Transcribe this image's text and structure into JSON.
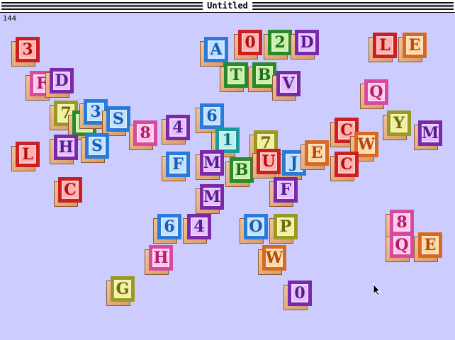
{
  "window": {
    "title": "Untitled",
    "counter": "144"
  },
  "colors": {
    "r": {
      "border": "#cc2020",
      "face": "#ffb0b0",
      "text": "#b01010"
    },
    "g": {
      "border": "#2a8a2a",
      "face": "#c8f0a8",
      "text": "#1e6e1e"
    },
    "b": {
      "border": "#2a7ad8",
      "face": "#bfe0ff",
      "text": "#1a5ab0"
    },
    "p": {
      "border": "#7a2aa8",
      "face": "#e2c0ff",
      "text": "#5a1a8a"
    },
    "o": {
      "border": "#d86a20",
      "face": "#ffd8a8",
      "text": "#b04a10"
    },
    "k": {
      "border": "#d84aa0",
      "face": "#ffc8e8",
      "text": "#b01a70"
    },
    "t": {
      "border": "#1a9a9a",
      "face": "#b8f0f0",
      "text": "#107070"
    },
    "y": {
      "border": "#9a9a20",
      "face": "#f0f0a0",
      "text": "#6a6a10"
    }
  },
  "tiles": [
    {
      "ch": "3",
      "c": "r"
    },
    {
      "ch": "F",
      "c": "k"
    },
    {
      "ch": "D",
      "c": "p"
    },
    {
      "ch": "7",
      "c": "y"
    },
    {
      "ch": "2",
      "c": "g"
    },
    {
      "ch": "3",
      "c": "b"
    },
    {
      "ch": "S",
      "c": "b"
    },
    {
      "ch": "H",
      "c": "p"
    },
    {
      "ch": "S",
      "c": "b"
    },
    {
      "ch": "L",
      "c": "r"
    },
    {
      "ch": "C",
      "c": "r"
    },
    {
      "ch": "8",
      "c": "k"
    },
    {
      "ch": "4",
      "c": "p"
    },
    {
      "ch": "F",
      "c": "b"
    },
    {
      "ch": "6",
      "c": "b"
    },
    {
      "ch": "1",
      "c": "t"
    },
    {
      "ch": "7",
      "c": "y"
    },
    {
      "ch": "M",
      "c": "p"
    },
    {
      "ch": "B",
      "c": "g"
    },
    {
      "ch": "J",
      "c": "b"
    },
    {
      "ch": "A",
      "c": "b"
    },
    {
      "ch": "0",
      "c": "r"
    },
    {
      "ch": "2",
      "c": "g"
    },
    {
      "ch": "D",
      "c": "p"
    },
    {
      "ch": "T",
      "c": "g"
    },
    {
      "ch": "B",
      "c": "g"
    },
    {
      "ch": "V",
      "c": "p"
    },
    {
      "ch": "U",
      "c": "r"
    },
    {
      "ch": "E",
      "c": "o"
    },
    {
      "ch": "M",
      "c": "p"
    },
    {
      "ch": "6",
      "c": "b"
    },
    {
      "ch": "4",
      "c": "p"
    },
    {
      "ch": "O",
      "c": "b"
    },
    {
      "ch": "P",
      "c": "y"
    },
    {
      "ch": "W",
      "c": "o"
    },
    {
      "ch": "H",
      "c": "k"
    },
    {
      "ch": "G",
      "c": "y"
    },
    {
      "ch": "0",
      "c": "p"
    },
    {
      "ch": "L",
      "c": "r"
    },
    {
      "ch": "E",
      "c": "o"
    },
    {
      "ch": "Q",
      "c": "k"
    },
    {
      "ch": "Y",
      "c": "y"
    },
    {
      "ch": "M",
      "c": "p"
    },
    {
      "ch": "C",
      "c": "r"
    },
    {
      "ch": "W",
      "c": "o"
    },
    {
      "ch": "C",
      "c": "r"
    },
    {
      "ch": "8",
      "c": "k"
    },
    {
      "ch": "Q",
      "c": "k"
    },
    {
      "ch": "E",
      "c": "o"
    },
    {
      "ch": "F",
      "c": "p"
    }
  ]
}
